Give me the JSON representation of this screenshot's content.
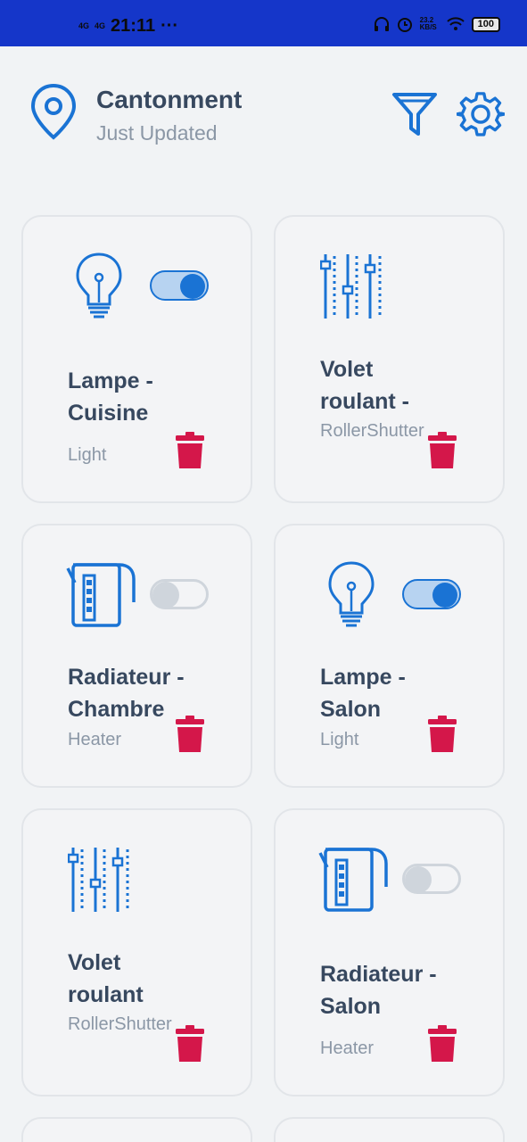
{
  "status_bar": {
    "signal_1": "4G",
    "signal_2": "4G",
    "time": "21:11",
    "extra": "···",
    "net_speed": "23.2 KB/S",
    "battery": "100"
  },
  "header": {
    "location": "Cantonment",
    "subtitle": "Just Updated",
    "location_icon": "map-pin-icon",
    "filter_icon": "filter-icon",
    "settings_icon": "gear-icon"
  },
  "colors": {
    "primary": "#1a73d4",
    "title_text": "#37485f",
    "muted_text": "#8b97a6",
    "delete": "#d4174a",
    "status_bar": "#1536c9"
  },
  "devices": [
    {
      "name": "Lampe - Cuisine",
      "type": "Light",
      "icon": "lightbulb-icon",
      "toggle": "on"
    },
    {
      "name": "Volet roulant -",
      "type": "RollerShutter",
      "icon": "sliders-icon",
      "toggle": "none"
    },
    {
      "name": "Radiateur - Chambre",
      "type": "Heater",
      "icon": "kettle-icon",
      "toggle": "off"
    },
    {
      "name": "Lampe - Salon",
      "type": "Light",
      "icon": "lightbulb-icon",
      "toggle": "on"
    },
    {
      "name": "Volet roulant",
      "type": "RollerShutter",
      "icon": "sliders-icon",
      "toggle": "none"
    },
    {
      "name": "Radiateur - Salon",
      "type": "Heater",
      "icon": "kettle-icon",
      "toggle": "off"
    }
  ]
}
